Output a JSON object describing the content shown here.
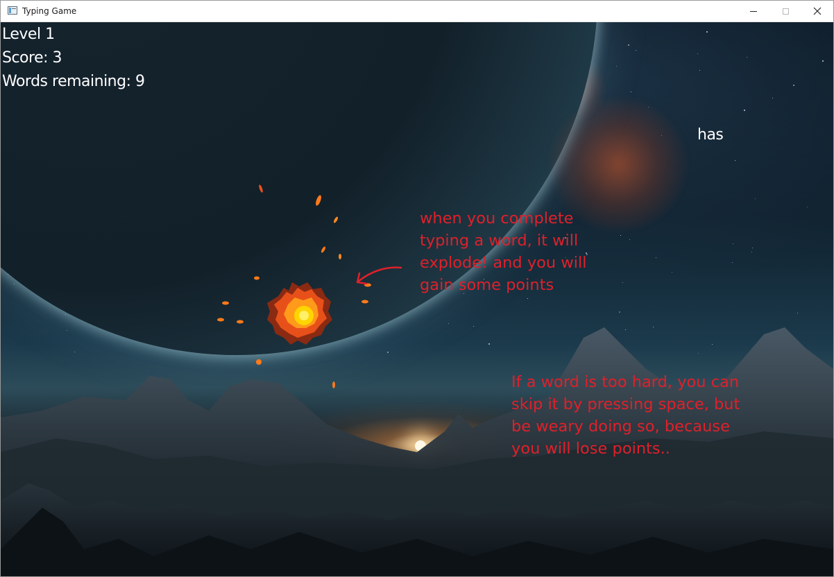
{
  "window": {
    "title": "Typing Game",
    "icon": "app-window-icon",
    "controls": [
      "minimize-icon",
      "maximize-icon",
      "close-icon"
    ]
  },
  "hud": {
    "level": "Level 1",
    "score": "Score: 3",
    "words_remaining": "Words remaining: 9"
  },
  "falling_word": "has",
  "annotations": [
    "when you complete typing a word, it will explode! and you will gain some points",
    "If a word is too hard, you can skip it by pressing space, but be weary doing so, because you will lose points.."
  ],
  "colors": {
    "hud_text": "#ffffff",
    "annotation": "#e0202a",
    "explosion_core": "#ffd400",
    "explosion_outer": "#e8501a"
  }
}
